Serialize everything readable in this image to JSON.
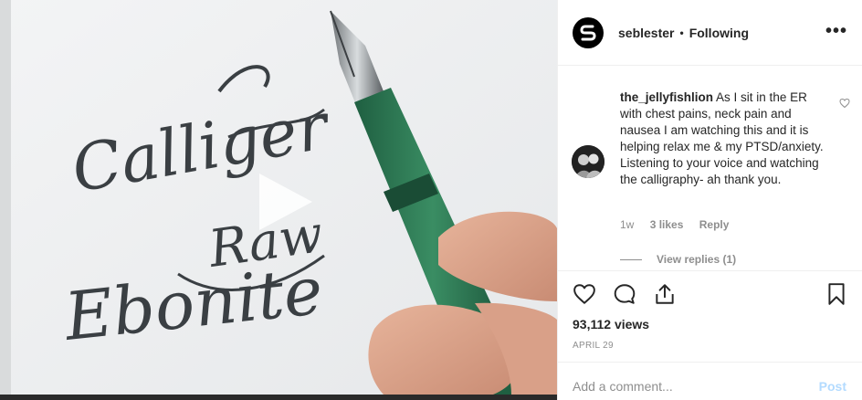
{
  "post": {
    "username": "seblester",
    "separator": "•",
    "follow_status": "Following",
    "more_label": "•••"
  },
  "video": {
    "calligraphy": {
      "line1": "Calliger",
      "line2": "Raw",
      "line3": "Ebonite"
    }
  },
  "comment": {
    "author": "the_jellyfishlion",
    "text": "As I sit in the ER with chest pains, neck pain and nausea I am watching this and it is helping relax me & my PTSD/anxiety. Listening to your voice and watching the calligraphy- ah thank you.",
    "time": "1w",
    "likes": "3 likes",
    "reply_label": "Reply",
    "view_replies": "View replies (1)"
  },
  "stats": {
    "views": "93,112 views",
    "date": "APRIL 29"
  },
  "composer": {
    "placeholder": "Add a comment...",
    "post_label": "Post"
  },
  "colors": {
    "pen_green": "#2e7a55",
    "ink": "#3a3f43",
    "link_disabled": "#b3dbff",
    "muted": "#8e8e8e"
  }
}
